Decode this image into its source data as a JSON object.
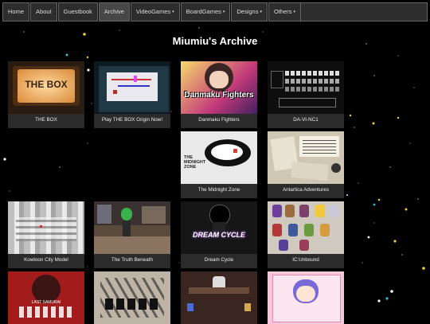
{
  "nav": {
    "items": [
      {
        "label": "Home"
      },
      {
        "label": "About"
      },
      {
        "label": "Guestbook"
      },
      {
        "label": "Archive"
      },
      {
        "label": "VideoGames"
      },
      {
        "label": "BoardGames"
      },
      {
        "label": "Designs"
      },
      {
        "label": "Others"
      }
    ],
    "caret": "▾"
  },
  "page_title": "Miumiu's Archive",
  "cards": [
    {
      "caption": "THE BOX",
      "art_text": "THE BOX"
    },
    {
      "caption": "Play THE BOX Origin Now!"
    },
    {
      "caption": "Danmaku Fighters",
      "art_text": "Danmaku Fighters"
    },
    {
      "caption": "DA-VI-NC1"
    },
    {
      "caption": "The Midnight Zone",
      "art_text": "THE MIDNIGHT ZONE"
    },
    {
      "caption": "Antartica Adventures"
    },
    {
      "caption": "Kowloon City Model"
    },
    {
      "caption": "The Truth Beneath"
    },
    {
      "caption": "Dream Cycle",
      "art_text": "DREAM CYCLE"
    },
    {
      "caption": "IC:Unbound"
    },
    {
      "art_text": "LAST SAMURAI"
    },
    {},
    {},
    {}
  ]
}
